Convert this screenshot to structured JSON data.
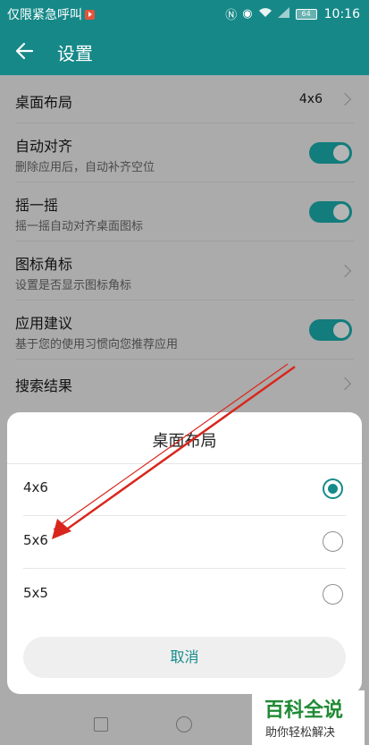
{
  "status_bar": {
    "carrier": "仅限紧急呼叫",
    "battery": "64",
    "time": "10:16"
  },
  "header": {
    "title": "设置",
    "back_icon": "arrow-left-icon"
  },
  "settings": {
    "rows": [
      {
        "title": "桌面布局",
        "value": "4x6",
        "control": "chevron"
      },
      {
        "title": "自动对齐",
        "subtitle": "删除应用后，自动补齐空位",
        "control": "toggle",
        "on": true
      },
      {
        "title": "摇一摇",
        "subtitle": "摇一摇自动对齐桌面图标",
        "control": "toggle",
        "on": true
      },
      {
        "title": "图标角标",
        "subtitle": "设置是否显示图标角标",
        "control": "chevron"
      },
      {
        "title": "应用建议",
        "subtitle": "基于您的使用习惯向您推荐应用",
        "control": "toggle",
        "on": true
      },
      {
        "title": "搜索结果",
        "control": "chevron"
      }
    ]
  },
  "dialog": {
    "title": "桌面布局",
    "options": [
      {
        "label": "4x6",
        "selected": true
      },
      {
        "label": "5x6",
        "selected": false
      },
      {
        "label": "5x5",
        "selected": false
      }
    ],
    "cancel_label": "取消"
  },
  "navbar": {
    "icons": [
      "recent-apps-icon",
      "home-icon"
    ]
  },
  "watermark": {
    "main": "百科全说",
    "sub": "助你轻松解决"
  },
  "colors": {
    "accent": "#168888",
    "annotation": "#d9261c",
    "scrim": "#ababab"
  }
}
